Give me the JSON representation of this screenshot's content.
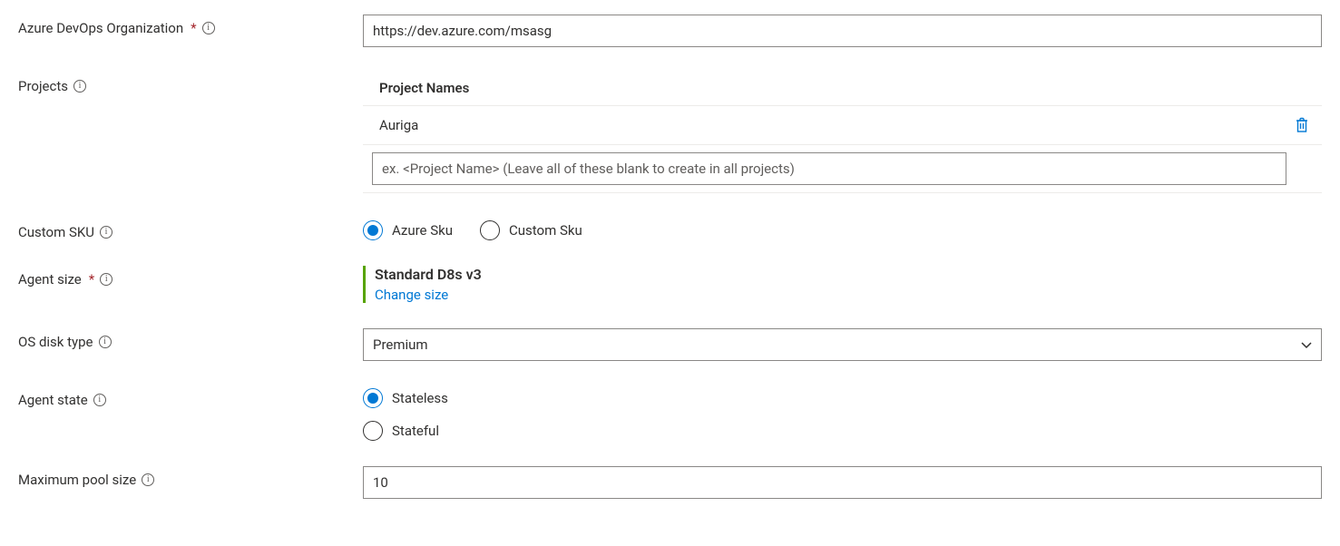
{
  "labels": {
    "org": "Azure DevOps Organization",
    "projects": "Projects",
    "customSku": "Custom SKU",
    "agentSize": "Agent size",
    "osDisk": "OS disk type",
    "agentState": "Agent state",
    "maxPool": "Maximum pool size"
  },
  "org": {
    "value": "https://dev.azure.com/msasg"
  },
  "projects": {
    "header": "Project Names",
    "items": [
      {
        "name": "Auriga"
      }
    ],
    "addPlaceholder": "ex. <Project Name> (Leave all of these blank to create in all projects)"
  },
  "sku": {
    "options": {
      "azure": "Azure Sku",
      "custom": "Custom Sku"
    },
    "selected": "azure"
  },
  "agentSize": {
    "name": "Standard D8s v3",
    "changeLink": "Change size"
  },
  "osDisk": {
    "value": "Premium"
  },
  "agentState": {
    "options": {
      "stateless": "Stateless",
      "stateful": "Stateful"
    },
    "selected": "stateless"
  },
  "maxPool": {
    "value": "10"
  }
}
